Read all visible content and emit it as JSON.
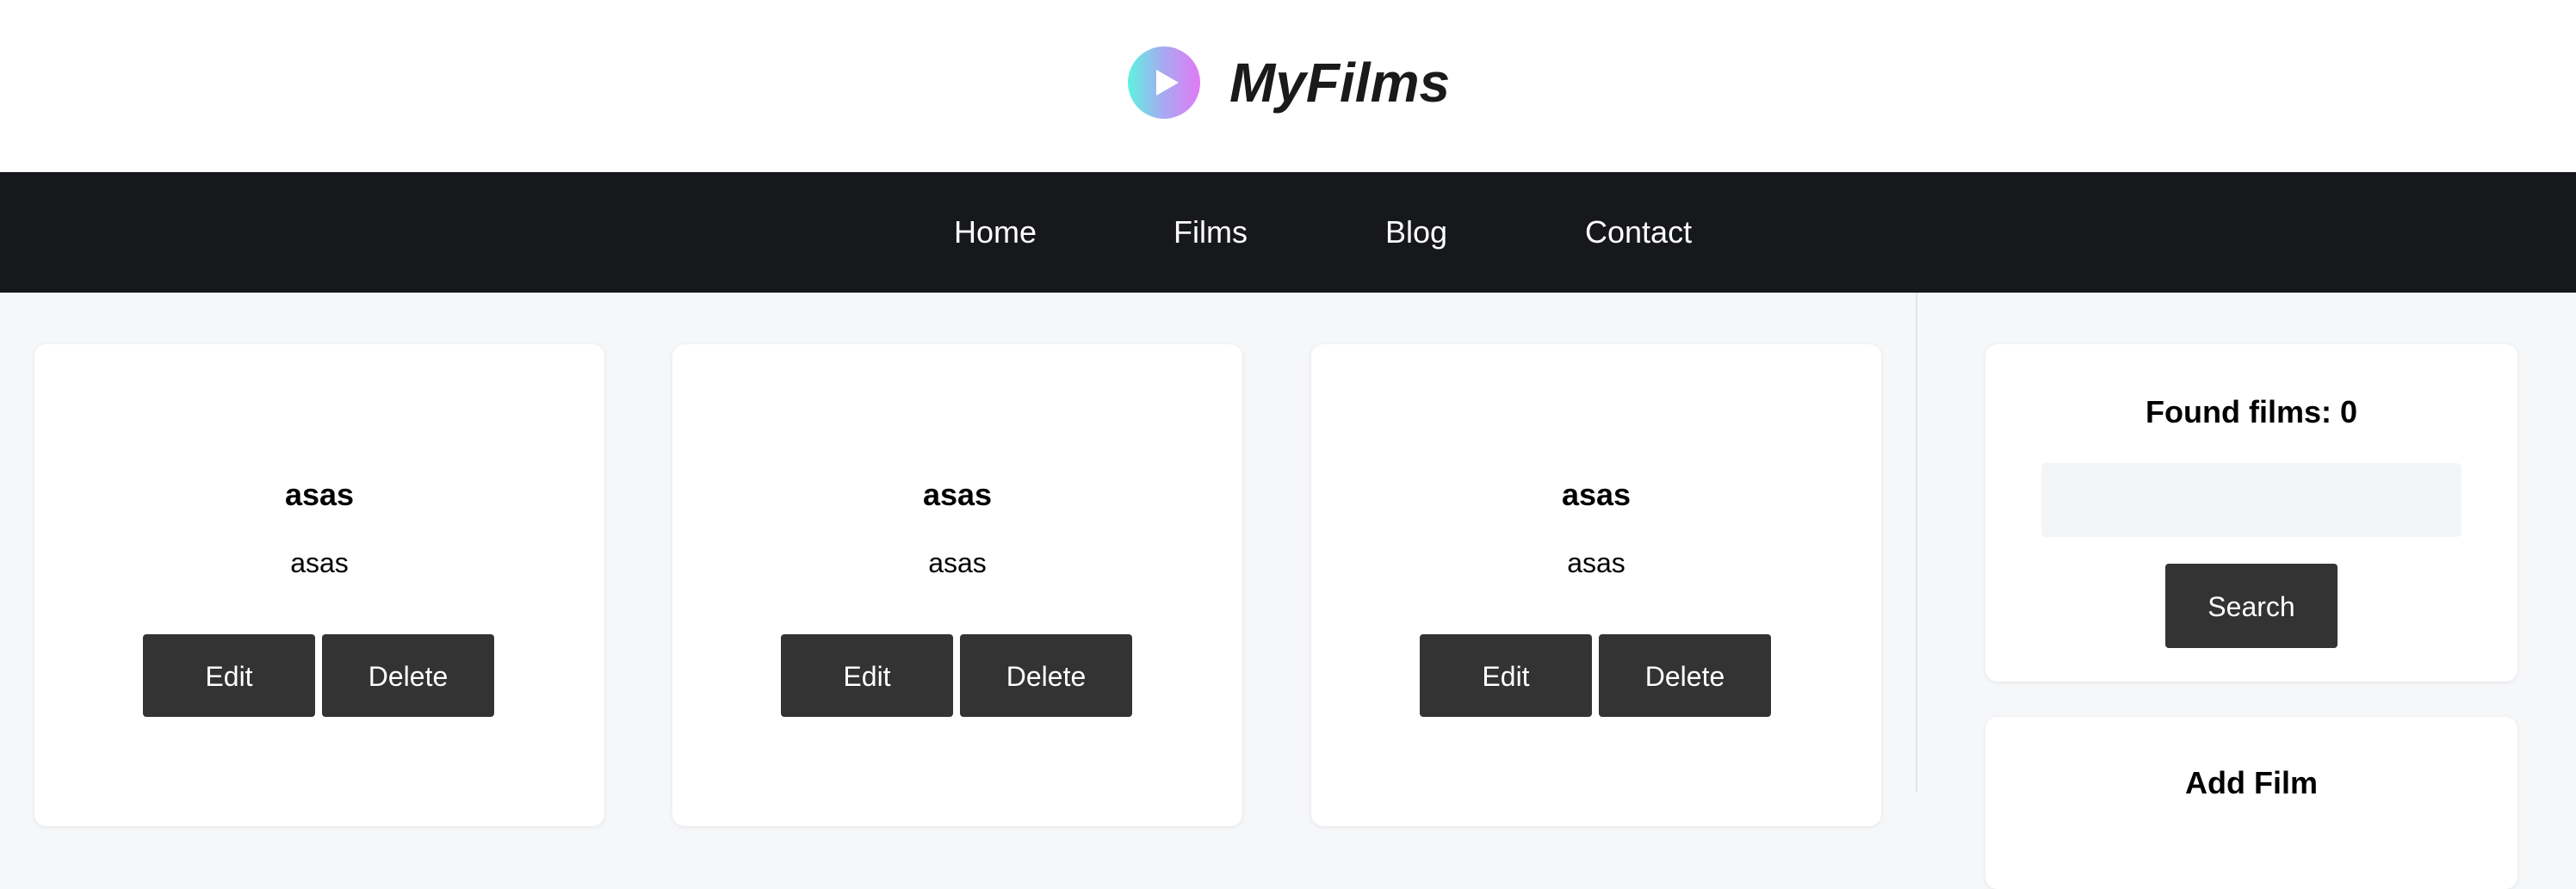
{
  "brand": {
    "name": "MyFilms",
    "logo_icon": "play-icon",
    "logo_gradient": [
      "#5ff2e0",
      "#e27af5"
    ]
  },
  "nav": {
    "items": [
      {
        "label": "Home"
      },
      {
        "label": "Films"
      },
      {
        "label": "Blog"
      },
      {
        "label": "Contact"
      }
    ]
  },
  "films": [
    {
      "title": "asas",
      "description": "asas",
      "edit_label": "Edit",
      "delete_label": "Delete"
    },
    {
      "title": "asas",
      "description": "asas",
      "edit_label": "Edit",
      "delete_label": "Delete"
    },
    {
      "title": "asas",
      "description": "asas",
      "edit_label": "Edit",
      "delete_label": "Delete"
    }
  ],
  "sidebar": {
    "found_label": "Found films: 0",
    "search_value": "",
    "search_button": "Search",
    "add_title": "Add Film"
  },
  "colors": {
    "navbar": "#17181c",
    "button": "#333333",
    "background": "#f6f7f9"
  }
}
